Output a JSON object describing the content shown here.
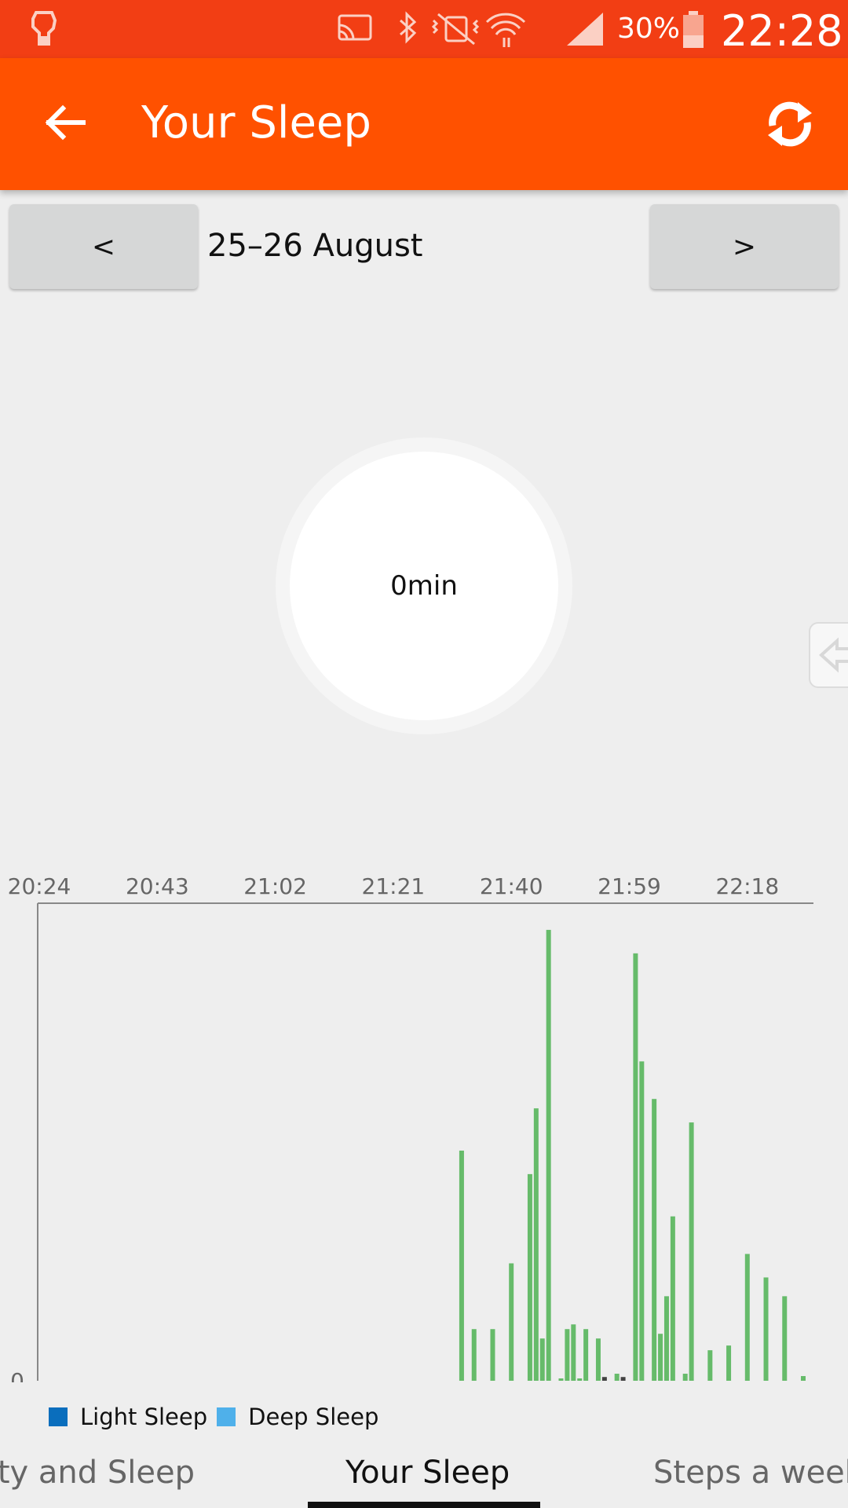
{
  "status_bar": {
    "battery_percent": "30%",
    "time": "22:28",
    "icons": [
      "app-notification-icon",
      "cast-icon",
      "bluetooth-icon",
      "vibrate-off-icon",
      "wifi-icon",
      "signal-icon",
      "battery-icon"
    ]
  },
  "app_bar": {
    "title": "Your Sleep",
    "back_icon": "arrow-left-icon",
    "refresh_icon": "refresh-icon",
    "background": "#ff5100"
  },
  "date_nav": {
    "prev_label": "<",
    "next_label": ">",
    "date": "25–26 August"
  },
  "summary": {
    "total_sleep": "0min"
  },
  "chart_data": {
    "type": "bar",
    "x_tick_labels": [
      "20:24",
      "20:43",
      "21:02",
      "21:21",
      "21:40",
      "21:59",
      "22:18"
    ],
    "y_tick_labels": [
      "0"
    ],
    "ylim": [
      0,
      100
    ],
    "grid": false,
    "legend_position": "bottom-left",
    "series": [
      {
        "color": "#66bb6a",
        "points": [
          {
            "x": "21:32",
            "y": 49
          },
          {
            "x": "21:34",
            "y": 11
          },
          {
            "x": "21:37",
            "y": 11
          },
          {
            "x": "21:40",
            "y": 25
          },
          {
            "x": "21:43",
            "y": 44
          },
          {
            "x": "21:44",
            "y": 58
          },
          {
            "x": "21:45",
            "y": 9
          },
          {
            "x": "21:46",
            "y": 96
          },
          {
            "x": "21:48",
            "y": 0.5
          },
          {
            "x": "21:49",
            "y": 11
          },
          {
            "x": "21:50",
            "y": 12
          },
          {
            "x": "21:51",
            "y": 0.5
          },
          {
            "x": "21:52",
            "y": 11
          },
          {
            "x": "21:54",
            "y": 9
          },
          {
            "x": "21:57",
            "y": 1.5
          },
          {
            "x": "22:00",
            "y": 91
          },
          {
            "x": "22:01",
            "y": 68
          },
          {
            "x": "22:03",
            "y": 60
          },
          {
            "x": "22:04",
            "y": 10
          },
          {
            "x": "22:05",
            "y": 18
          },
          {
            "x": "22:06",
            "y": 35
          },
          {
            "x": "22:08",
            "y": 1.5
          },
          {
            "x": "22:09",
            "y": 55
          },
          {
            "x": "22:12",
            "y": 6.5
          },
          {
            "x": "22:15",
            "y": 7.5
          },
          {
            "x": "22:18",
            "y": 27
          },
          {
            "x": "22:21",
            "y": 22
          },
          {
            "x": "22:24",
            "y": 18
          },
          {
            "x": "22:27",
            "y": 1
          }
        ]
      },
      {
        "color": "#424242",
        "points": [
          {
            "x": "21:55",
            "y": 0.8
          },
          {
            "x": "21:58",
            "y": 0.8
          }
        ]
      }
    ],
    "x_domain": [
      "20:24",
      "22:29"
    ]
  },
  "legend": [
    {
      "label": "Light Sleep",
      "color": "#0a6ebd"
    },
    {
      "label": "Deep Sleep",
      "color": "#4fb0ea"
    }
  ],
  "tabs": [
    {
      "label": "ity and Sleep"
    },
    {
      "label": "Your Sleep"
    },
    {
      "label": "Steps a week"
    }
  ]
}
